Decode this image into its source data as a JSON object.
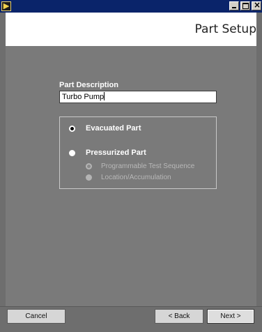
{
  "window": {
    "title": "",
    "controls": {
      "minimize": "minimize",
      "maximize": "maximize",
      "close": "close"
    },
    "title_bar_color": "#0a246a"
  },
  "header": {
    "page_title": "Part Setup"
  },
  "form": {
    "description_label": "Part Description",
    "description_value": "Turbo Pump",
    "options": {
      "evacuated": {
        "label": "Evacuated Part",
        "selected": true
      },
      "pressurized": {
        "label": "Pressurized Part",
        "selected": false
      },
      "sub_options": [
        {
          "label": "Programmable Test Sequence",
          "selected": true,
          "enabled": false
        },
        {
          "label": "Location/Accumulation",
          "selected": false,
          "enabled": false
        }
      ]
    }
  },
  "footer": {
    "cancel_label": "Cancel",
    "back_label": "< Back",
    "next_label": "Next >"
  },
  "colors": {
    "panel_bg": "#7a7a7a",
    "header_bg": "#ffffff",
    "label_text": "#ffffff",
    "disabled_text": "#b8b8b8"
  }
}
